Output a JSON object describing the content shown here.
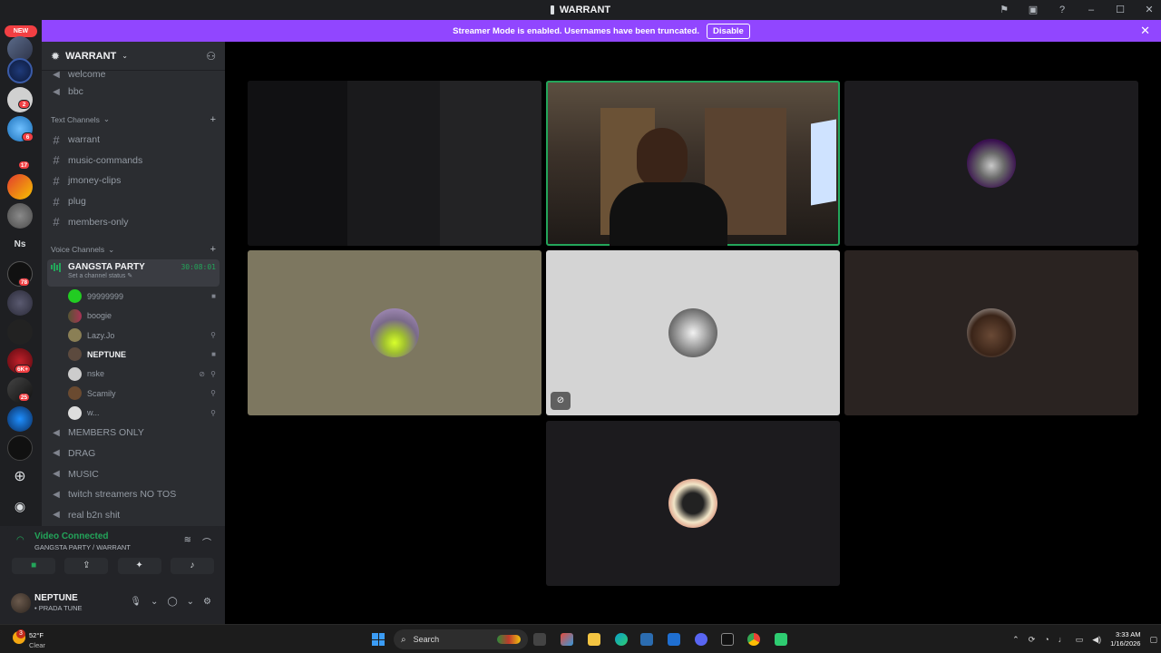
{
  "window": {
    "title": "WARRANT"
  },
  "banner": {
    "message": "Streamer Mode is enabled. Usernames have been truncated.",
    "disable_label": "Disable"
  },
  "rail": {
    "new_label": "NEW",
    "ns_label": "Ns",
    "badges": [
      "2",
      "6",
      "17",
      "78",
      "6K+",
      "25"
    ]
  },
  "server": {
    "name": "WARRANT"
  },
  "channels_top": [
    {
      "type": "voice",
      "name": "welcome"
    },
    {
      "type": "voice",
      "name": "bbc"
    }
  ],
  "text_category": "Text Channels",
  "text_channels": [
    "warrant",
    "music-commands",
    "jmoney-clips",
    "plug",
    "members-only"
  ],
  "voice_category": "Voice Channels",
  "active_voice": {
    "name": "GANGSTA PARTY",
    "timer": "30:08:01",
    "status": "Set a channel status"
  },
  "members": [
    {
      "name": "99999999",
      "bold": false
    },
    {
      "name": "boogie",
      "bold": false
    },
    {
      "name": "Lazy.Jo",
      "bold": false
    },
    {
      "name": "NEPTUNE",
      "bold": true
    },
    {
      "name": "nske",
      "bold": false
    },
    {
      "name": "Scamily",
      "bold": false
    },
    {
      "name": "w...",
      "bold": false
    }
  ],
  "voice_channels": [
    "MEMBERS ONLY",
    "DRAG",
    "MUSIC",
    "twitch streamers NO TOS",
    "real b2n shit"
  ],
  "voice_panel": {
    "title": "Video Connected",
    "subtitle": "GANGSTA PARTY / WARRANT"
  },
  "user": {
    "name": "NEPTUNE",
    "status": "• PRADA TUNE"
  },
  "taskbar": {
    "temp": "52°F",
    "condition": "Clear",
    "search": "Search",
    "time": "3:33 AM",
    "date": "1/16/2026"
  },
  "colors": {
    "accent": "#9146ff",
    "speaking": "#23a55a",
    "danger": "#f23f43"
  }
}
